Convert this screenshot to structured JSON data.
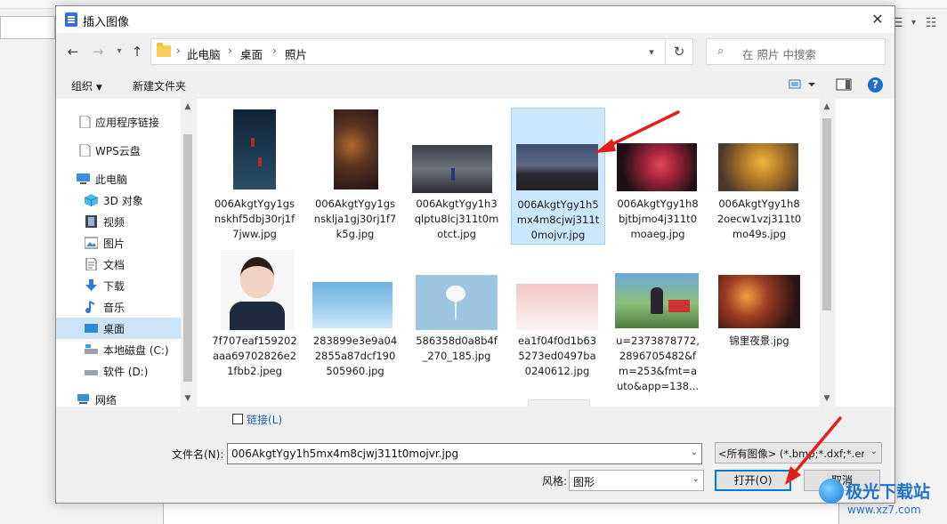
{
  "dialog": {
    "title": "插入图像",
    "close_glyph": "✕"
  },
  "nav": {
    "back": "←",
    "forward": "→",
    "up": "↑",
    "breadcrumb": [
      "此电脑",
      "桌面",
      "照片"
    ],
    "refresh": "↻",
    "search_placeholder": "在 照片 中搜索"
  },
  "commands": {
    "organize": "组织",
    "new_folder": "新建文件夹",
    "help": "?"
  },
  "sidebar": {
    "items": [
      {
        "label": "应用程序链接",
        "icon": "document-icon"
      },
      {
        "label": "WPS云盘",
        "icon": "document-icon"
      },
      {
        "label": "此电脑",
        "icon": "computer-icon"
      },
      {
        "label": "3D 对象",
        "icon": "cube-icon"
      },
      {
        "label": "视频",
        "icon": "video-icon"
      },
      {
        "label": "图片",
        "icon": "picture-icon"
      },
      {
        "label": "文档",
        "icon": "document-icon"
      },
      {
        "label": "下载",
        "icon": "download-icon"
      },
      {
        "label": "音乐",
        "icon": "music-icon"
      },
      {
        "label": "桌面",
        "icon": "desktop-icon",
        "selected": true
      },
      {
        "label": "本地磁盘 (C:)",
        "icon": "drive-icon"
      },
      {
        "label": "软件 (D:)",
        "icon": "drive-icon"
      },
      {
        "label": "网络",
        "icon": "network-icon"
      }
    ]
  },
  "files": [
    {
      "name": "006AkgtYgy1gsnskhf5dbj30rj1f7jww.jpg",
      "lines": [
        "006AkgtYgy1gs",
        "nskhf5dbj30rj1f",
        "7jww.jpg"
      ]
    },
    {
      "name": "006AkgtYgy1gsnsklja1gj30rj1f7k5g.jpg",
      "lines": [
        "006AkgtYgy1gs",
        "nsklja1gj30rj1f7",
        "k5g.jpg"
      ]
    },
    {
      "name": "006AkgtYgy1h3qlptu8lcj311t0motct.jpg",
      "lines": [
        "006AkgtYgy1h3",
        "qlptu8lcj311t0m",
        "otct.jpg"
      ]
    },
    {
      "name": "006AkgtYgy1h5mx4m8cjwj311t0mojvr.jpg",
      "lines": [
        "006AkgtYgy1h5",
        "mx4m8cjwj311t",
        "0mojvr.jpg"
      ],
      "selected": true
    },
    {
      "name": "006AkgtYgy1h8bjtbjmo4j311t0moaeg.jpg",
      "lines": [
        "006AkgtYgy1h8",
        "bjtbjmo4j311t0",
        "moaeg.jpg"
      ]
    },
    {
      "name": "006AkgtYgy1h82oecw1vzj311t0mo49s.jpg",
      "lines": [
        "006AkgtYgy1h8",
        "2oecw1vzj311t0",
        "mo49s.jpg"
      ]
    },
    {
      "name": "7f707eaf159202aaa69702826e21fbb2.jpeg",
      "lines": [
        "7f707eaf159202",
        "aaa69702826e2",
        "1fbb2.jpeg"
      ]
    },
    {
      "name": "283899e3e9a042855a87dcf190505960.jpg",
      "lines": [
        "283899e3e9a04",
        "2855a87dcf190",
        "505960.jpg"
      ]
    },
    {
      "name": "586358d0a8b4f_270_185.jpg",
      "lines": [
        "586358d0a8b4f",
        "_270_185.jpg"
      ]
    },
    {
      "name": "ea1f04f0d1b635273ed0497ba0240612.jpg",
      "lines": [
        "ea1f04f0d1b63",
        "5273ed0497ba",
        "0240612.jpg"
      ]
    },
    {
      "name": "u=2373878772,2896705482&fm=253&fmt=auto&app=138...",
      "lines": [
        "u=2373878772,",
        "2896705482&f",
        "m=253&fmt=a",
        "uto&app=138..."
      ]
    },
    {
      "name": "锦里夜景.jpg",
      "lines": [
        "锦里夜景.jpg"
      ]
    }
  ],
  "bottom": {
    "link_label": "链接(L)",
    "filename_label": "文件名(N):",
    "filename_value": "006AkgtYgy1h5mx4m8cjwj311t0mojvr.jpg",
    "filetype_value": "<所有图像> (*.emf;*.wmf;*.jpg;*.jpeg;*.jfif;*.jpe;*.png;*.bmp;*.dxf;*.em",
    "filetype_visible": "<所有图像> (*.bmp;*.dxf;*.em",
    "style_label": "风格:",
    "style_value": "图形",
    "open_button": "打开(O)",
    "cancel_button": "取消"
  },
  "watermark": {
    "brand": "极光下载站",
    "url": "www.xz7.com"
  },
  "colors": {
    "selection": "#cce8ff",
    "accent": "#0078d7",
    "annotation_arrow": "#e0201a"
  }
}
